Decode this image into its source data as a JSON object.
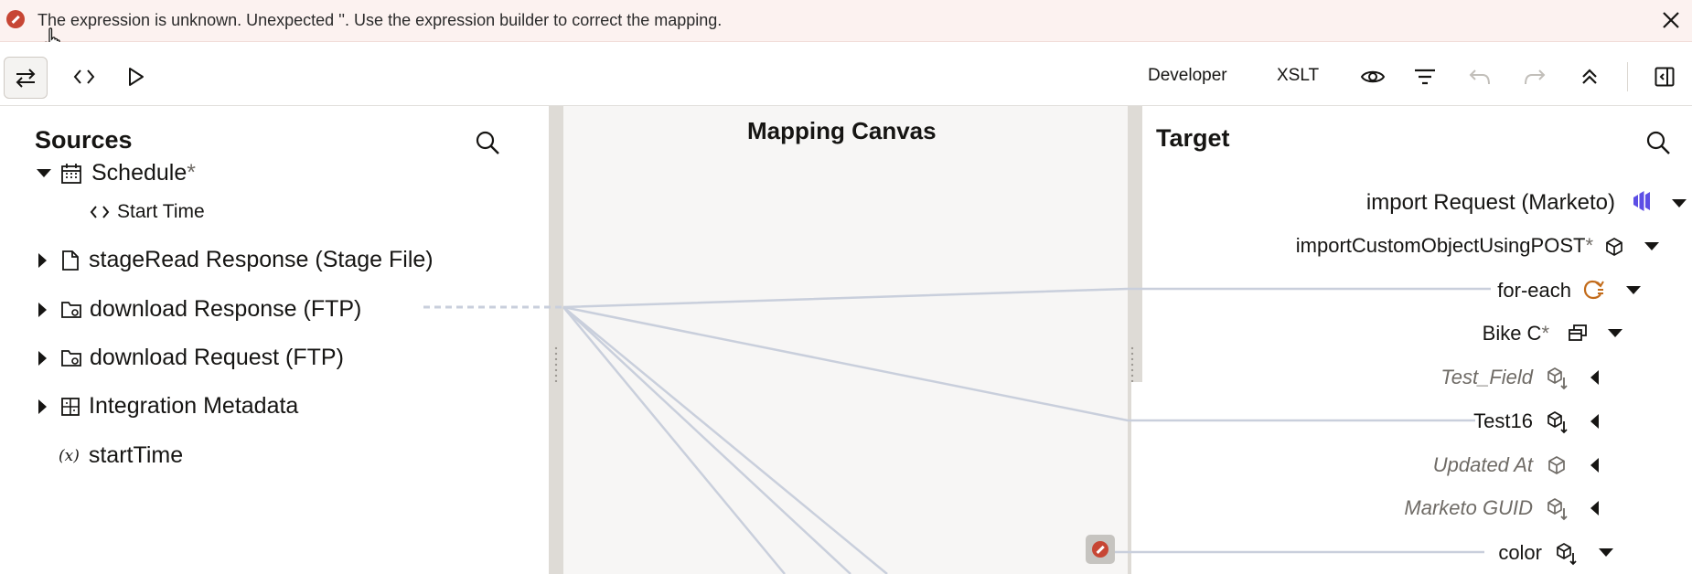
{
  "banner": {
    "message": "The expression is unknown. Unexpected ''. Use the expression builder to correct the mapping."
  },
  "toolbar": {
    "developer_label": "Developer",
    "xslt_label": "XSLT"
  },
  "sources": {
    "title": "Sources",
    "items": [
      {
        "label": "Schedule",
        "suffix": "*",
        "icon": "calendar-icon",
        "expanded": true
      },
      {
        "label": "Start Time",
        "icon": "code-icon",
        "child": true
      },
      {
        "label": "stageRead Response (Stage File)",
        "icon": "file-icon"
      },
      {
        "label": "download Response (FTP)",
        "icon": "folder-icon"
      },
      {
        "label": "download Request (FTP)",
        "icon": "folder-icon"
      },
      {
        "label": "Integration Metadata",
        "icon": "metadata-icon"
      },
      {
        "label": "startTime",
        "icon": "variable-icon"
      }
    ],
    "variable_icon_text": "(x)"
  },
  "canvas": {
    "title": "Mapping Canvas"
  },
  "target": {
    "title": "Target",
    "items": [
      {
        "label": "import Request (Marketo)",
        "icon": "marketo-icon"
      },
      {
        "label": "importCustomObjectUsingPOST",
        "suffix": "*",
        "icon": "cube-icon"
      },
      {
        "label": "for-each",
        "icon": "loop-icon"
      },
      {
        "label": "Bike C",
        "suffix": "*",
        "icon": "copy-icon"
      },
      {
        "label": "Test_Field",
        "icon": "cube-download-icon",
        "italic": true
      },
      {
        "label": "Test16",
        "icon": "cube-download-icon"
      },
      {
        "label": "Updated At",
        "icon": "cube-icon",
        "italic": true
      },
      {
        "label": "Marketo GUID",
        "icon": "cube-download-icon",
        "italic": true
      },
      {
        "label": "color",
        "icon": "cube-download-icon"
      }
    ]
  },
  "colors": {
    "error_red": "#c74634",
    "banner_bg": "#fcf2f0",
    "mapping_line": "#c9cfdc",
    "loop_orange": "#c26b1a",
    "marketo_purple": "#5c4ee5"
  }
}
